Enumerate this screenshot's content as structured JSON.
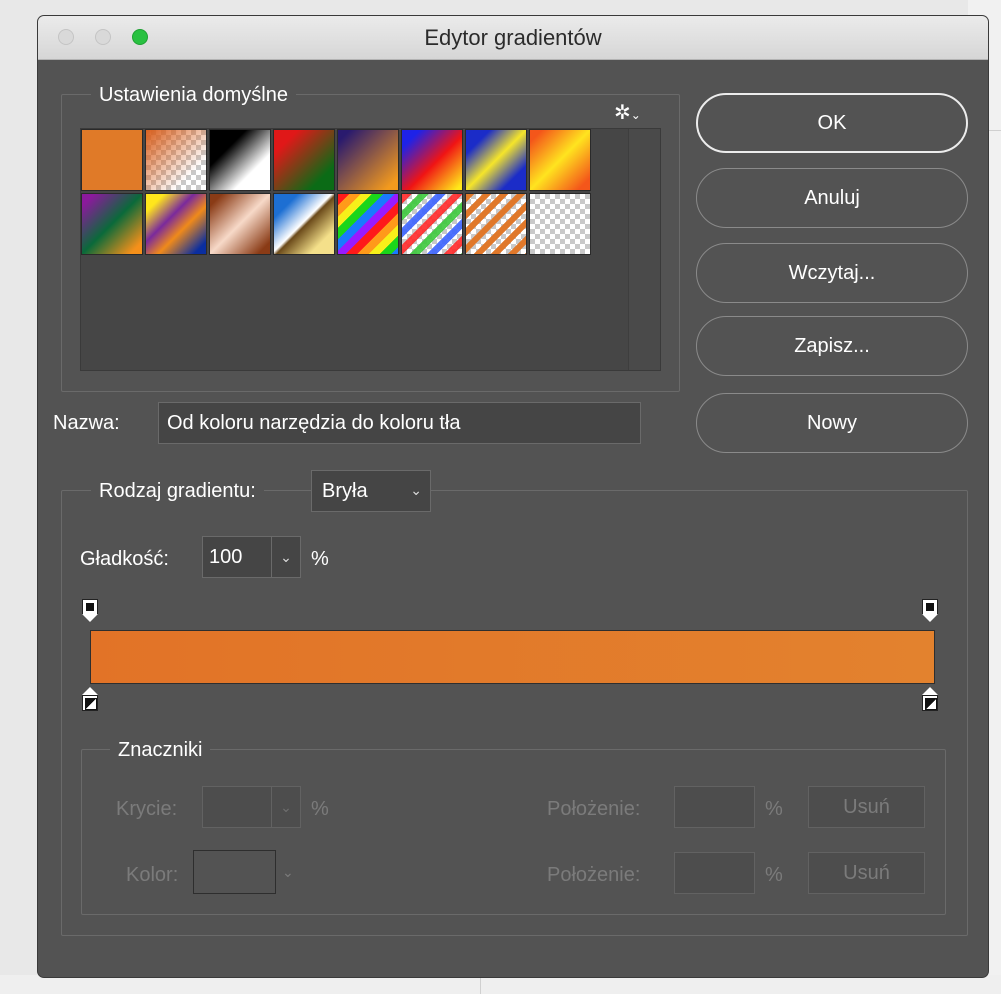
{
  "window": {
    "title": "Edytor gradientów"
  },
  "presets": {
    "label": "Ustawienia domyślne",
    "swatches": [
      {
        "name": "swatch-fg-to-bg",
        "bg": "linear-gradient(135deg,#e07a28,#e07a28)"
      },
      {
        "name": "swatch-fg-to-transparent",
        "bg": "linear-gradient(135deg,#d9601e 0%,rgba(217,96,30,0) 75%)",
        "checker": true
      },
      {
        "name": "swatch-black-white",
        "bg": "linear-gradient(135deg,#000 30%,#fff 70%)"
      },
      {
        "name": "swatch-red-green",
        "bg": "linear-gradient(135deg,#e01818 20%,#0b6b16 80%)"
      },
      {
        "name": "swatch-violet-orange",
        "bg": "linear-gradient(135deg,#2a1a6e 10%,#f39a1d 90%)"
      },
      {
        "name": "swatch-blue-red-yellow",
        "bg": "linear-gradient(135deg,#1e22e8 15%,#f01414 55%,#ffe91a 95%)"
      },
      {
        "name": "swatch-blue-yellow-blue",
        "bg": "linear-gradient(135deg,#1b2cc8 20%,#f5e52a 50%,#1b2cc8 80%)"
      },
      {
        "name": "swatch-orange-yellow-orange",
        "bg": "linear-gradient(135deg,#f4561a 10%,#ffe41f 50%,#f4561a 90%)"
      },
      {
        "name": "swatch-violet-green-orange",
        "bg": "linear-gradient(135deg,#8b1a9c 10%,#0a6a3a 50%,#f5901a 90%)"
      },
      {
        "name": "swatch-yellow-violet-orange-blue",
        "bg": "linear-gradient(135deg,#ffe61c 15%,#7a2a9c 40%,#f08a1a 60%,#0a2ea0 90%)"
      },
      {
        "name": "swatch-copper",
        "bg": "linear-gradient(135deg,#8a3b16 10%,#f7d9c8 50%,#8a3b16 90%)"
      },
      {
        "name": "swatch-chrome",
        "bg": "linear-gradient(135deg,#1d6fd3 20%,#ffffff 48%,#6b4a1a 52%,#f4e08a 80%)"
      },
      {
        "name": "swatch-spectrum",
        "bg": "repeating-linear-gradient(135deg,#ff1a1a 0 8px,#ff9a1a 8px 16px,#f7f01a 16px 24px,#1ad61a 24px 32px,#1a7aff 32px 40px,#9a1aff 40px 48px)"
      },
      {
        "name": "swatch-transparent-rainbow",
        "bg": "repeating-linear-gradient(135deg,rgba(255,40,40,0.9) 0 7px,rgba(255,255,255,0) 7px 12px,rgba(60,200,60,0.9) 12px 19px,rgba(255,255,255,0) 19px 24px,rgba(60,100,255,0.9) 24px 31px,rgba(255,255,255,0) 31px 36px)",
        "checker": true
      },
      {
        "name": "swatch-transparent-stripes",
        "bg": "repeating-linear-gradient(135deg,#e0782a 0 6px,rgba(255,255,255,0) 6px 12px)",
        "checker": true
      },
      {
        "name": "swatch-transparent-empty",
        "bg": "linear-gradient(135deg,rgba(255,255,255,0),rgba(255,255,255,0))",
        "checker": true
      }
    ]
  },
  "buttons": {
    "ok": "OK",
    "cancel": "Anuluj",
    "load": "Wczytaj...",
    "save": "Zapisz...",
    "new": "Nowy"
  },
  "name_row": {
    "label": "Nazwa:",
    "value": "Od koloru narzędzia do koloru tła"
  },
  "gradient": {
    "type_label": "Rodzaj gradientu:",
    "type_value": "Bryła",
    "smoothness_label": "Gładkość:",
    "smoothness_value": "100",
    "smoothness_unit": "%",
    "start_color": "#e27327",
    "end_color": "#e3822e"
  },
  "markers": {
    "label": "Znaczniki",
    "opacity_label": "Krycie:",
    "opacity_unit": "%",
    "color_label": "Kolor:",
    "position_label_1": "Położenie:",
    "position_label_2": "Położenie:",
    "position_unit_1": "%",
    "position_unit_2": "%",
    "delete_1": "Usuń",
    "delete_2": "Usuń"
  }
}
